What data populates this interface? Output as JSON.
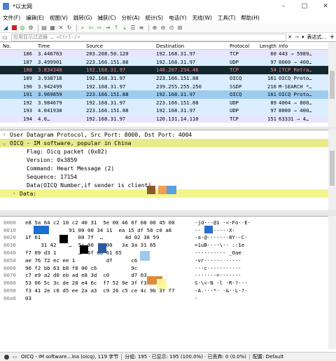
{
  "window": {
    "title": "*以太网"
  },
  "menu": [
    "文件(F)",
    "编辑(E)",
    "视图(V)",
    "跳转(G)",
    "捕获(C)",
    "分析(A)",
    "统计(S)",
    "电话(Y)",
    "无线(W)",
    "工具(T)",
    "帮助(H)"
  ],
  "filter": {
    "placeholder": "应用显示过滤器 … <Ctrl-/>",
    "expression_label": "表达式…",
    "add_label": "+"
  },
  "packet_list": {
    "columns": [
      "No.",
      "Time",
      "Source",
      "Destination",
      "Protocol",
      "Length",
      "Info"
    ],
    "rows": [
      {
        "no": "186",
        "time": "3.446763",
        "src": "203.208.50.120",
        "dst": "192.168.31.97",
        "proto": "TCP",
        "len": "60",
        "info": "443 → 5989…",
        "bg": "#e7e6ff",
        "fg": "#000000"
      },
      {
        "no": "187",
        "time": "3.499901",
        "src": "223.166.151.88",
        "dst": "192.168.31.97",
        "proto": "UDP",
        "len": "97",
        "info": "8000 → 400…",
        "bg": "#daeeff",
        "fg": "#000000"
      },
      {
        "no": "188",
        "time": "3.834348",
        "src": "192.168.31.97",
        "dst": "140.207.234.46",
        "proto": "TCP",
        "len": "54",
        "info": "[TCP Retra…",
        "bg": "#12272e",
        "fg": "#f78787"
      },
      {
        "no": "189",
        "time": "3.938718",
        "src": "192.168.31.97",
        "dst": "223.166.151.88",
        "proto": "OICQ",
        "len": "161",
        "info": "OICQ Proto…",
        "bg": "#daeeff",
        "fg": "#000000"
      },
      {
        "no": "190",
        "time": "3.942499",
        "src": "192.168.31.97",
        "dst": "239.255.255.250",
        "proto": "SSDP",
        "len": "216",
        "info": "M-SEARCH *…",
        "bg": "#daeeff",
        "fg": "#000000"
      },
      {
        "no": "191",
        "time": "3.969859",
        "src": "223.166.151.88",
        "dst": "192.168.31.97",
        "proto": "OICQ",
        "len": "161",
        "info": "OICQ Proto…",
        "bg": "#9ecbee",
        "fg": "#000000"
      },
      {
        "no": "192",
        "time": "3.984679",
        "src": "192.168.31.97",
        "dst": "223.166.151.88",
        "proto": "UDP",
        "len": "89",
        "info": "4004 → 800…",
        "bg": "#daeeff",
        "fg": "#000000"
      },
      {
        "no": "193",
        "time": "4.041938",
        "src": "223.166.151.88",
        "dst": "192.168.31.97",
        "proto": "UDP",
        "len": "97",
        "info": "8000 → 400…",
        "bg": "#daeeff",
        "fg": "#000000"
      },
      {
        "no": "194",
        "time": "4.0…",
        "src": "192.168.31.97",
        "dst": "120.131.14.110",
        "proto": "TCP",
        "len": "151",
        "info": "63331 → 4…",
        "bg": "#e7e6ff",
        "fg": "#000000"
      }
    ]
  },
  "details": [
    {
      "text": "User Datagram Protocol, Src Port: 8000, Dst Port: 4004",
      "arrow": "›",
      "bg": "#ffffff"
    },
    {
      "text": "OICQ - IM software, popular in China",
      "arrow": "⌄",
      "bg": "#eae98c"
    },
    {
      "text": "Flag: Oicq packet (0x02)",
      "arrow": "",
      "bg": "#ffffff"
    },
    {
      "text": "Version: 0x3859",
      "arrow": "",
      "bg": "#ffffff"
    },
    {
      "text": "Command: Heart Message (2)",
      "arrow": "",
      "bg": "#ffffff"
    },
    {
      "text": "Sequence: 17154",
      "arrow": "",
      "bg": "#ffffff"
    },
    {
      "text": "Data(OICQ Number,if sender is client)",
      "arrow": "",
      "bg": "#ffffff"
    },
    {
      "text": "Data:",
      "arrow": "›",
      "bg": "#f3f58c"
    }
  ],
  "hex": [
    {
      "off": "0000",
      "bytes": "e8 5a 64 c2 10 c2 40 31  5e 00 46 6f 08 00 45 00",
      "ascii": "·jd···@1 ·<·Fo··E·"
    },
    {
      "off": "0010",
      "bytes": "              91 00 00 34 11  ea 15 df 58 c0 a8",
      "ascii": "·· ········X·"
    },
    {
      "off": "0020",
      "bytes": "1f 61            00 7f  …       4d 02 38 59",
      "ascii": "·a·@·······8Y··C·"
    },
    {
      "off": "0030",
      "bytes": "     31 42    …  5c 00  … 00   3a 3a 31 65",
      "ascii": "=1uB····\\·· ::1e"
    },
    {
      "off": "0040",
      "bytes": "f7 09 d3 1       …  6f 6d 61 65",
      "ascii": "·········· _Oae"
    },
    {
      "off": "0050",
      "bytes": "ae 76 72 ec ee 1          df      c6",
      "ascii": "·vr······ ····· "
    },
    {
      "off": "0060",
      "bytes": "96 f2 bb 63 b8 f8 00 c6           9c",
      "ascii": "···c··········· "
    },
    {
      "off": "0070",
      "bytes": "c7 e9 a2 d0 eb ad e8 3d  c0       d7 03",
      "ascii": "·······=·······  "
    },
    {
      "off": "0080",
      "bytes": "53 06 5c 3c de 20 e4 6c  f7 52 9e 3f f3 10",
      "ascii": "S·\\<·N ·l ·R·?···"
    },
    {
      "off": "0090",
      "bytes": "f3 41 2e c6 d5 ee 2a a3  c9 26 c5 ce 4c 9b 3f f7",
      "ascii": "·A.···*· ·&··L·?·"
    },
    {
      "off": "00a0",
      "bytes": "03",
      "ascii": "·"
    }
  ],
  "status": {
    "field": "OICQ - IM software…ina (oicq), 119 字节",
    "packets": "分组: 195",
    "displayed": "· 已显示: 195 (100.0%)",
    "dropped": "· 已丢弃: 0 (0.0%)",
    "profile": "配置: Default"
  },
  "colors": {
    "selected_detail": "#eae98c",
    "highlight_data": "#f3f58c",
    "oicq_row": "#9ecbee"
  }
}
